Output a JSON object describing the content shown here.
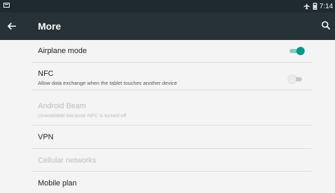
{
  "status_bar": {
    "time": "7:14",
    "icons": [
      "notification-icon",
      "airplane-icon",
      "battery-icon"
    ]
  },
  "app_bar": {
    "title": "More",
    "icons": [
      "back-arrow-icon",
      "search-icon"
    ]
  },
  "settings": [
    {
      "label": "Airplane mode",
      "toggle": "on",
      "enabled": true
    },
    {
      "label": "NFC",
      "summary": "Allow data exchange when the tablet touches another device",
      "toggle": "off",
      "enabled": true
    },
    {
      "label": "Android Beam",
      "summary": "Unavailable because NFC is turned off",
      "enabled": false
    },
    {
      "label": "VPN",
      "enabled": true
    },
    {
      "label": "Cellular networks",
      "enabled": false
    },
    {
      "label": "Mobile plan",
      "enabled": true
    }
  ],
  "colors": {
    "app_bar": "#263238",
    "status_bar": "#1e2a2f",
    "accent": "#009688",
    "background": "#f4f4f4"
  }
}
